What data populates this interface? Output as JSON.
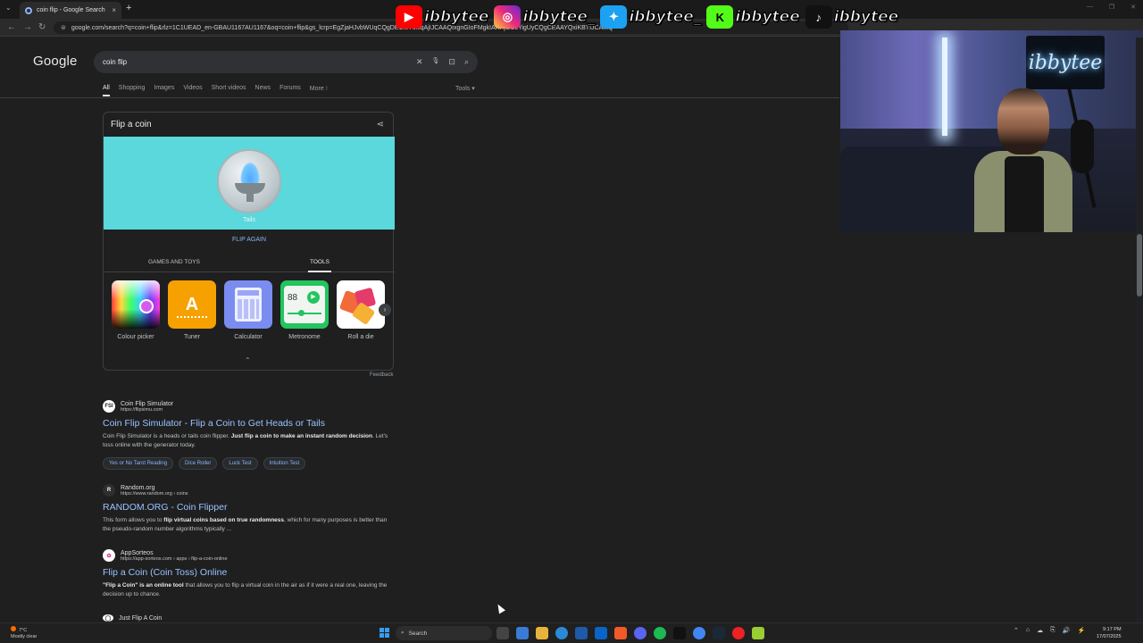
{
  "browser": {
    "tab_title": "coin flip - Google Search",
    "tab_close": "×",
    "new_tab": "+",
    "tab_list": "⌄",
    "url": "google.com/search?q=coin+flip&rlz=1C1UEAD_en-GBAU1167AU1167&oq=coin+flip&gs_lcrp=EgZjaHJvbWUqCQgDECMYJxiqAjIJCAAQIxgnGIoFMgkIARAjGCcYigUyCQgCEAAYQxiKBTIJCAMQ",
    "back": "←",
    "forward": "→",
    "reload": "↻",
    "info_icon": "⊜",
    "window_controls": [
      "—",
      "❐",
      "✕"
    ]
  },
  "stream_banner": [
    {
      "platform": "youtube-icon",
      "symbol": "▶",
      "color": "#ff0000",
      "handle": "ibbytee"
    },
    {
      "platform": "instagram-icon",
      "symbol": "◎",
      "color": "#d6249f",
      "handle": "ibbytee_"
    },
    {
      "platform": "twitter-icon",
      "symbol": "✦",
      "color": "#1da1f2",
      "handle": "ibbytee_"
    },
    {
      "platform": "kick-icon",
      "symbol": "K",
      "color": "#53fc18",
      "handle": "ibbytee"
    },
    {
      "platform": "tiktok-icon",
      "symbol": "♪",
      "color": "#111111",
      "handle": "ibbytee"
    }
  ],
  "google": {
    "logo": "Google",
    "query": "coin flip",
    "clear_icon": "✕",
    "mic_icon": "🎙",
    "lens_icon": "⊡",
    "search_icon": "⌕",
    "filters": [
      "All",
      "Shopping",
      "Images",
      "Videos",
      "Short videos",
      "News",
      "Forums",
      "More ⁝"
    ],
    "tools": "Tools ▾"
  },
  "coin_card": {
    "title": "Flip a coin",
    "share_icon": "⋖",
    "result_label": "Tails",
    "flip_again": "FLIP AGAIN",
    "tab_games": "GAMES AND TOYS",
    "tab_tools": "TOOLS",
    "tiles": [
      {
        "label": "Colour picker"
      },
      {
        "label": "Tuner",
        "glyph": "A"
      },
      {
        "label": "Calculator"
      },
      {
        "label": "Metronome",
        "glyph": "88"
      },
      {
        "label": "Roll a die"
      }
    ],
    "next": "›",
    "collapse": "⌃",
    "feedback": "Feedback"
  },
  "results": [
    {
      "favicon": "FSI",
      "site": "Coin Flip Simulator",
      "url": "https://flipsimu.com",
      "title": "Coin Flip Simulator - Flip a Coin to Get Heads or Tails",
      "snippet_a": "Coin Flip Simulator is a heads or tails coin flipper. ",
      "snippet_b": "Just flip a coin to make an instant random decision",
      "snippet_c": ". Let's toss online with the generator today.",
      "chips": [
        "Yes or No Tarot Reading",
        "Dice Roller",
        "Luck Test",
        "Intuition Test"
      ]
    },
    {
      "favicon": "R",
      "site": "Random.org",
      "url": "https://www.random.org › coins",
      "title": "RANDOM.ORG - Coin Flipper",
      "snippet_a": "This form allows you to ",
      "snippet_b": "flip virtual coins based on true randomness",
      "snippet_c": ", which for many purposes is better than the pseudo-random number algorithms typically ..."
    },
    {
      "favicon": "✿",
      "site": "AppSorteos",
      "url": "https://app-sorteos.com › apps › flip-a-coin-online",
      "title": "Flip a Coin (Coin Toss) Online",
      "snippet_a": "",
      "snippet_b": "\"Flip a Coin\" is an online tool",
      "snippet_c": " that allows you to flip a virtual coin in the air as if it were a real one, leaving the decision up to chance."
    },
    {
      "favicon": "◯",
      "site": "Just Flip A Coin"
    }
  ],
  "webcam": {
    "sign_text": "ibbytee"
  },
  "taskbar": {
    "temperature": "7°C",
    "weather": "Mostly clear",
    "search_placeholder": "Search",
    "time": "9:17 PM",
    "date": "17/07/2025",
    "tray": [
      "⌃",
      "⌂",
      "☁",
      "⎘",
      "🔊",
      "⚡"
    ]
  }
}
